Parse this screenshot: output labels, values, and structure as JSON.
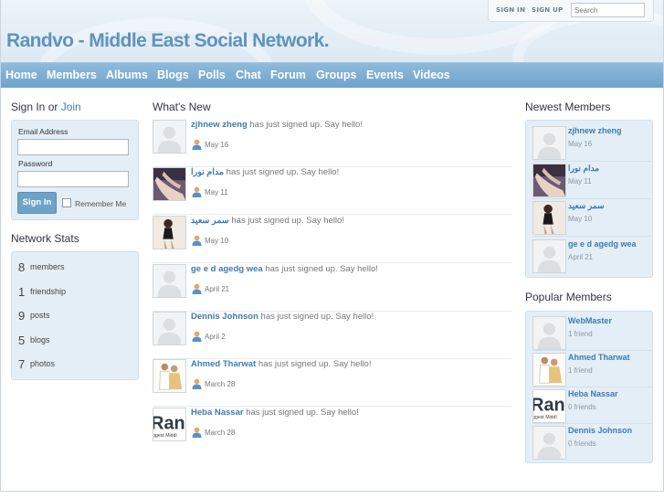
{
  "site_title": "Randvo - Middle East Social Network.",
  "topbar": {
    "sign_in": "SIGN IN",
    "sign_up": "SIGN UP",
    "search_placeholder": "Search"
  },
  "nav": [
    "Home",
    "Members",
    "Albums",
    "Blogs",
    "Polls",
    "Chat",
    "Forum",
    "Groups",
    "Events",
    "Videos"
  ],
  "signin": {
    "title": "Sign In or",
    "join": "Join",
    "email_label": "Email Address",
    "password_label": "Password",
    "button": "Sign In",
    "remember": "Remember Me"
  },
  "stats": {
    "title": "Network Stats",
    "items": [
      {
        "num": "8",
        "label": "members"
      },
      {
        "num": "1",
        "label": "friendship"
      },
      {
        "num": "9",
        "label": "posts"
      },
      {
        "num": "5",
        "label": "blogs"
      },
      {
        "num": "7",
        "label": "photos"
      }
    ]
  },
  "whats_new": {
    "title": "What's New",
    "items": [
      {
        "name": "zjhnew zheng",
        "text": "has just signed up. Say hello!",
        "date": "May 16",
        "avatar": "blank"
      },
      {
        "name": "مدام نورا",
        "text": "has just signed up. Say hello!",
        "date": "May 11",
        "avatar": "photo-legs"
      },
      {
        "name": "سمر سعيد",
        "text": "has just signed up. Say hello!",
        "date": "May 10",
        "avatar": "photo-woman"
      },
      {
        "name": "ge e d agedg wea",
        "text": "has just signed up. Say hello!",
        "date": "April 21",
        "avatar": "blank"
      },
      {
        "name": "Dennis Johnson",
        "text": "has just signed up. Say hello!",
        "date": "April 2",
        "avatar": "blank"
      },
      {
        "name": "Ahmed Tharwat",
        "text": "has just signed up. Say hello!",
        "date": "March 28",
        "avatar": "photo-couple"
      },
      {
        "name": "Heba Nassar",
        "text": "has just signed up. Say hello!",
        "date": "March 28",
        "avatar": "logo"
      }
    ]
  },
  "newest_members": {
    "title": "Newest Members",
    "items": [
      {
        "name": "zjhnew zheng",
        "sub": "May 16",
        "avatar": "blank"
      },
      {
        "name": "مدام نورا",
        "sub": "May 11",
        "avatar": "photo-legs"
      },
      {
        "name": "سمر سعيد",
        "sub": "May 10",
        "avatar": "photo-woman"
      },
      {
        "name": "ge e d agedg wea",
        "sub": "April 21",
        "avatar": "blank"
      }
    ]
  },
  "popular_members": {
    "title": "Popular Members",
    "items": [
      {
        "name": "WebMaster",
        "sub": "1 friend",
        "avatar": "blank"
      },
      {
        "name": "Ahmed Tharwat",
        "sub": "1 friend",
        "avatar": "photo-couple"
      },
      {
        "name": "Heba Nassar",
        "sub": "0 friends",
        "avatar": "logo"
      },
      {
        "name": "Dennis Johnson",
        "sub": "0 friends",
        "avatar": "blank"
      }
    ]
  },
  "logo_avatar_text": {
    "big": "Ran",
    "small": "ggest Middl"
  },
  "colors": {
    "nav": "#7aadd3",
    "link": "#3f7bb0",
    "panel": "#e4eef6",
    "title": "#5f93bd"
  }
}
